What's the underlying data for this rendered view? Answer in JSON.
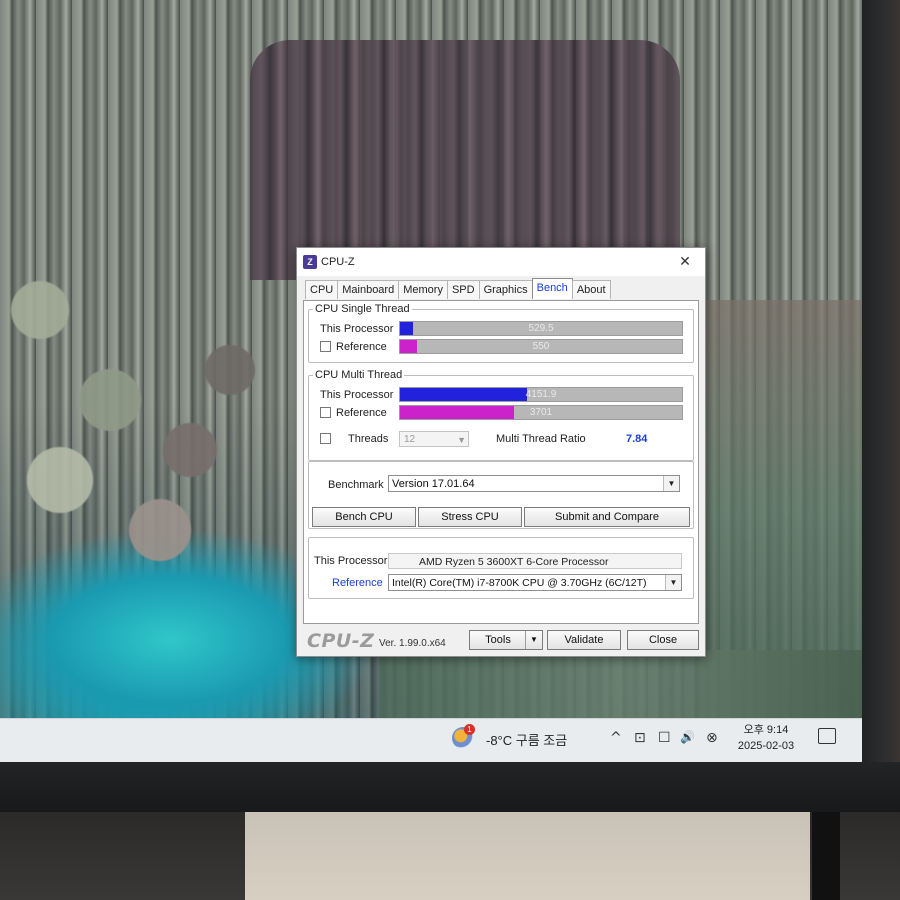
{
  "window": {
    "title": "CPU-Z",
    "app_icon": "cpuz-app-icon",
    "close_glyph": "✕"
  },
  "tabs": [
    {
      "label": "CPU",
      "active": false
    },
    {
      "label": "Mainboard",
      "active": false
    },
    {
      "label": "Memory",
      "active": false
    },
    {
      "label": "SPD",
      "active": false
    },
    {
      "label": "Graphics",
      "active": false
    },
    {
      "label": "Bench",
      "active": true
    },
    {
      "label": "About",
      "active": false
    }
  ],
  "single_thread": {
    "legend": "CPU Single Thread",
    "this_label": "This Processor",
    "this_value": "529.5",
    "this_fraction": 0.045,
    "this_color": "#2222dd",
    "ref_label": "Reference",
    "ref_value": "550",
    "ref_fraction": 0.06,
    "ref_color": "#cc22cc"
  },
  "multi_thread": {
    "legend": "CPU Multi Thread",
    "this_label": "This Processor",
    "this_value": "4151.9",
    "this_fraction": 0.45,
    "this_color": "#2222dd",
    "ref_label": "Reference",
    "ref_value": "3701",
    "ref_fraction": 0.405,
    "ref_color": "#cc22cc",
    "threads_label": "Threads",
    "threads_value": "12",
    "ratio_label": "Multi Thread Ratio",
    "ratio_value": "7.84"
  },
  "benchmark": {
    "label": "Benchmark",
    "selected": "Version 17.01.64",
    "bench_cpu": "Bench CPU",
    "stress_cpu": "Stress CPU",
    "submit": "Submit and Compare"
  },
  "processor": {
    "this_label": "This Processor",
    "this_value": "AMD Ryzen 5 3600XT 6-Core Processor",
    "ref_label": "Reference",
    "ref_value": "Intel(R) Core(TM) i7-8700K CPU @ 3.70GHz (6C/12T)"
  },
  "footer": {
    "logo": "CPU-Z",
    "version": "Ver. 1.99.0.x64",
    "tools": "Tools",
    "validate": "Validate",
    "close": "Close"
  },
  "taskbar": {
    "weather_badge": "1",
    "weather_text": "-8°C  구름 조금",
    "time": "오후 9:14",
    "date": "2025-02-03",
    "tray_icons": [
      "chevron-up-icon",
      "display-icon",
      "network-icon",
      "volume-icon",
      "disabled-icon"
    ],
    "tray_glyphs": [
      "^",
      "⊡",
      "☐",
      "🔊",
      "⊗"
    ]
  }
}
